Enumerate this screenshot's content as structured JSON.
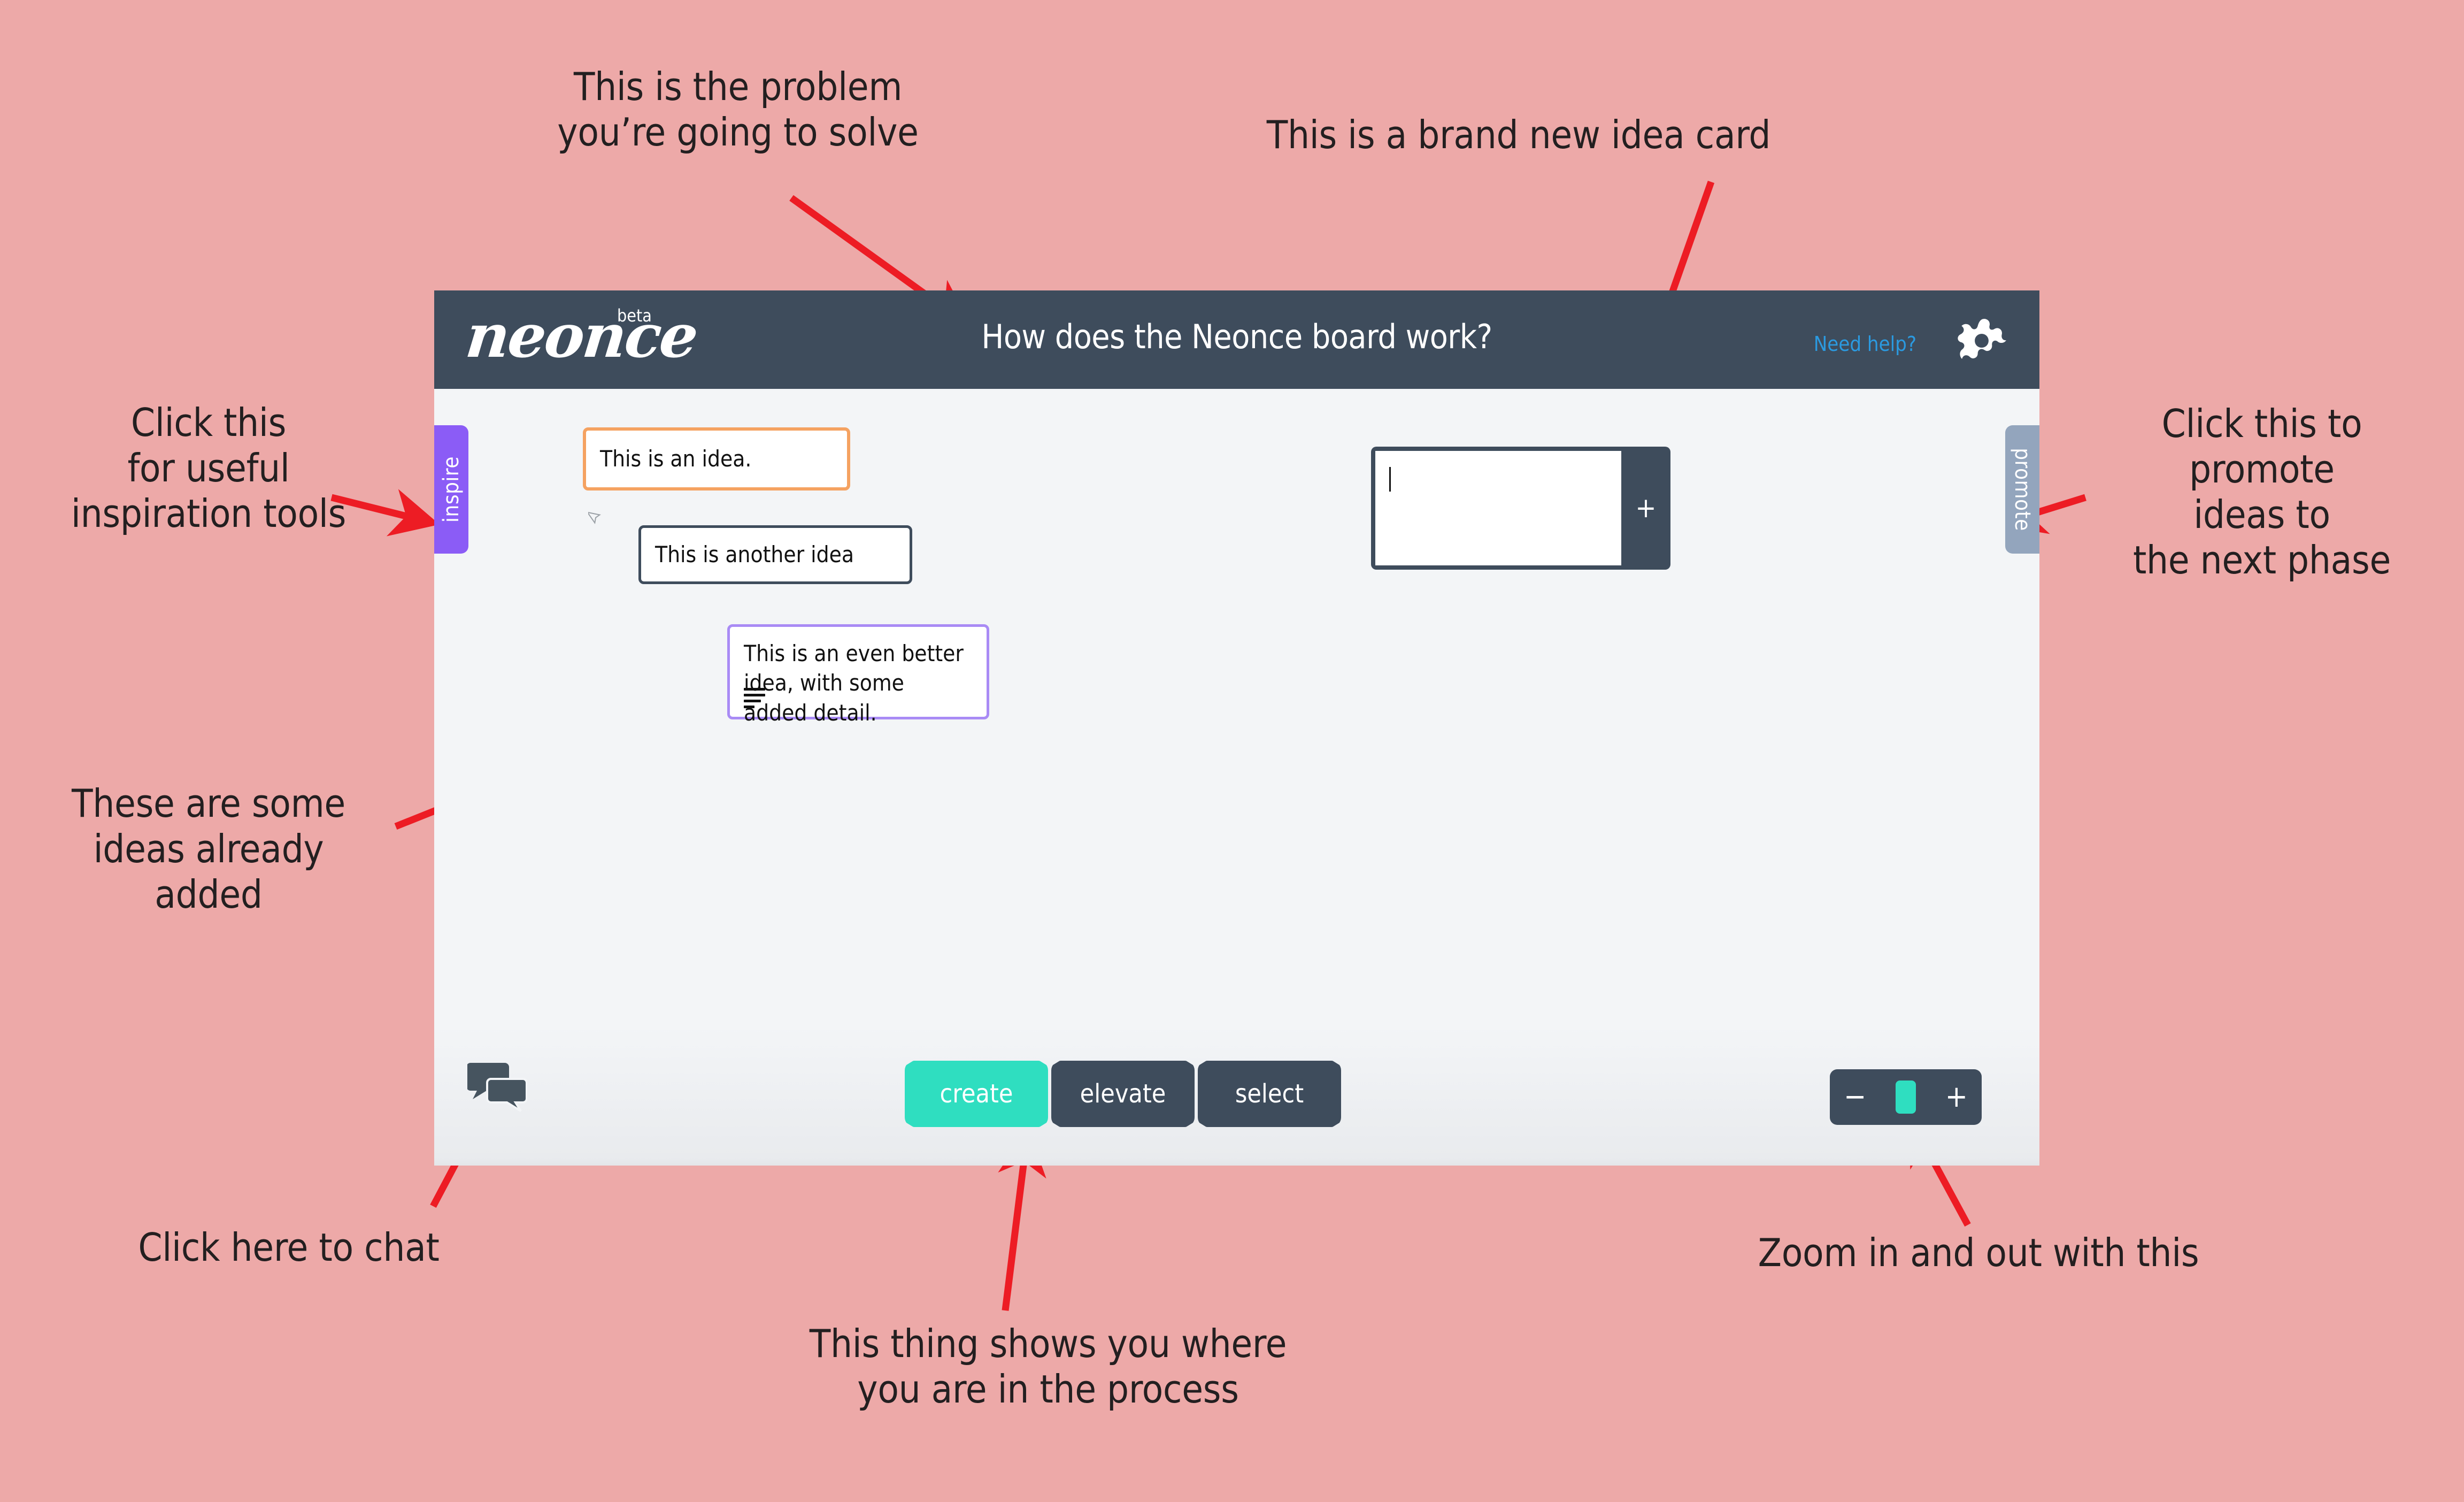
{
  "theme": {
    "page_background": "#eda9a8",
    "annotation_text": "#231f20",
    "arrow": "#ed1c24",
    "header_bg": "#3e4c5c",
    "canvas_bg": "#f3f5f7",
    "accent_teal": "#2fdec0",
    "accent_purple": "#8b5cf6",
    "accent_orange": "#f5a261",
    "accent_lavender": "#a98bf5",
    "promote_blue": "#93a5bd",
    "need_help_blue": "#2b9ae0"
  },
  "header": {
    "logo": "neonce",
    "logo_badge": "beta",
    "board_title": "How does the Neonce board work?",
    "need_help_label": "Need help?",
    "settings_icon": "gear-icon"
  },
  "side_tabs": {
    "inspire_label": "inspire",
    "promote_label": "promote"
  },
  "ideas": [
    {
      "text": "This is an idea.",
      "border_color": "#f5a261"
    },
    {
      "text": "This is another idea",
      "border_color": "#3e4c5c"
    },
    {
      "text": "This is an even better idea, with some added detail.",
      "border_color": "#a98bf5",
      "has_detail_icon": true
    }
  ],
  "new_idea": {
    "value": "",
    "placeholder": "",
    "add_label": "+"
  },
  "chat": {
    "icon": "chat-bubbles-icon"
  },
  "phases": [
    {
      "label": "create",
      "active": true
    },
    {
      "label": "elevate",
      "active": false
    },
    {
      "label": "select",
      "active": false
    }
  ],
  "zoom_control": {
    "zoom_out_label": "−",
    "zoom_in_label": "+"
  },
  "annotations": [
    {
      "id": "problem",
      "text": "This is the problem\nyou’re going to solve"
    },
    {
      "id": "new-idea-card",
      "text": "This is a brand new idea card"
    },
    {
      "id": "inspire",
      "text": "Click this\nfor useful\ninspiration tools"
    },
    {
      "id": "promote",
      "text": "Click this to\npromote\nideas to\nthe next phase"
    },
    {
      "id": "existing-ideas",
      "text": "These are some\nideas already\nadded"
    },
    {
      "id": "chat",
      "text": "Click here to chat"
    },
    {
      "id": "phases",
      "text": "This thing shows you where\nyou are in the process"
    },
    {
      "id": "zoom",
      "text": "Zoom in and out with this"
    }
  ]
}
